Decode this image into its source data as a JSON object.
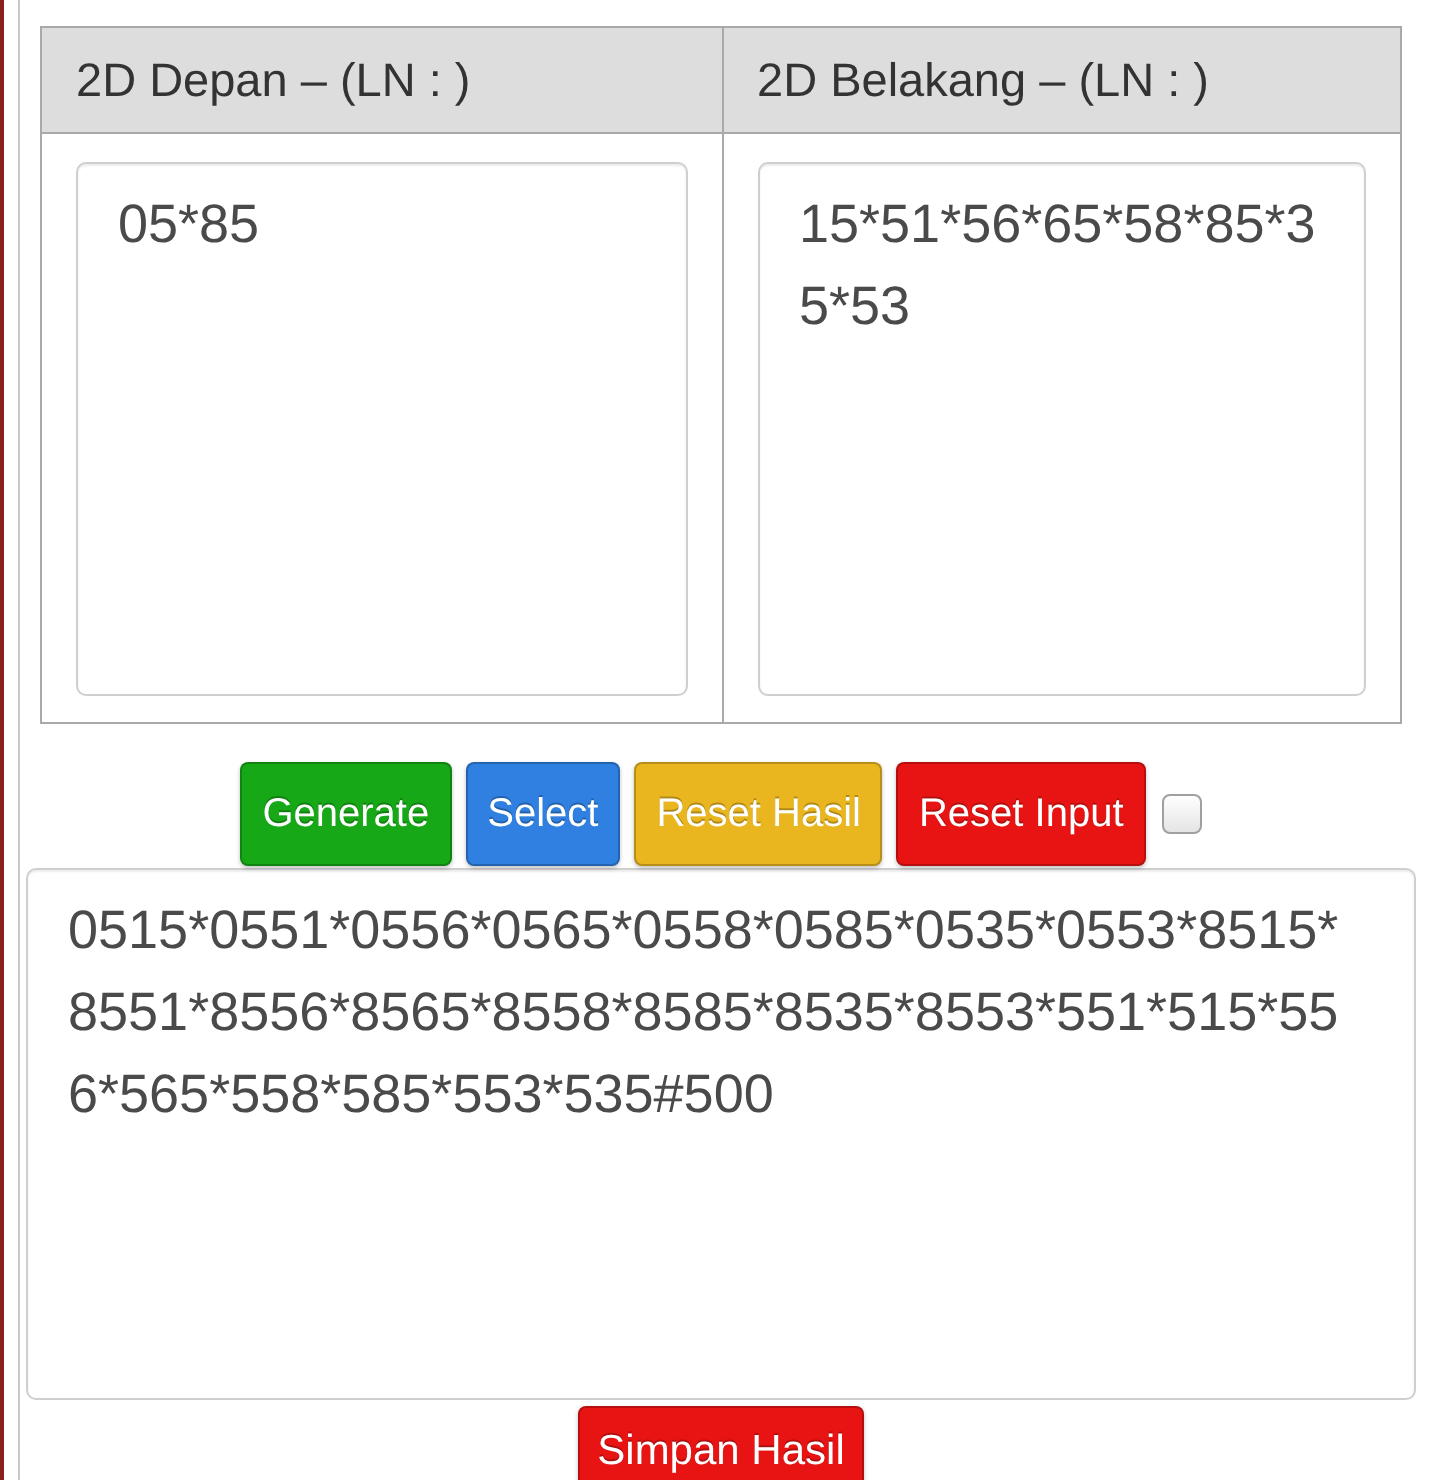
{
  "table": {
    "columns": [
      {
        "heading": "2D Depan – (LN : )",
        "input": "05*85"
      },
      {
        "heading": "2D Belakang – (LN : )",
        "input": "15*51*56*65*58*85*35*53"
      }
    ]
  },
  "buttons": [
    {
      "label": "Generate",
      "color": "#17a817"
    },
    {
      "label": "Select",
      "color": "#2f80e0"
    },
    {
      "label": "Reset Hasil",
      "color": "#eab61f"
    },
    {
      "label": "Reset Input",
      "color": "#e81414"
    }
  ],
  "checkbox": {
    "checked": false
  },
  "result": {
    "value": "0515*0551*0556*0565*0558*0585*0535*0553*8515*8551*8556*8565*8558*8585*8535*8553*551*515*556*565*558*585*553*535#500"
  },
  "save_button": {
    "label": "Simpan Hasil"
  }
}
